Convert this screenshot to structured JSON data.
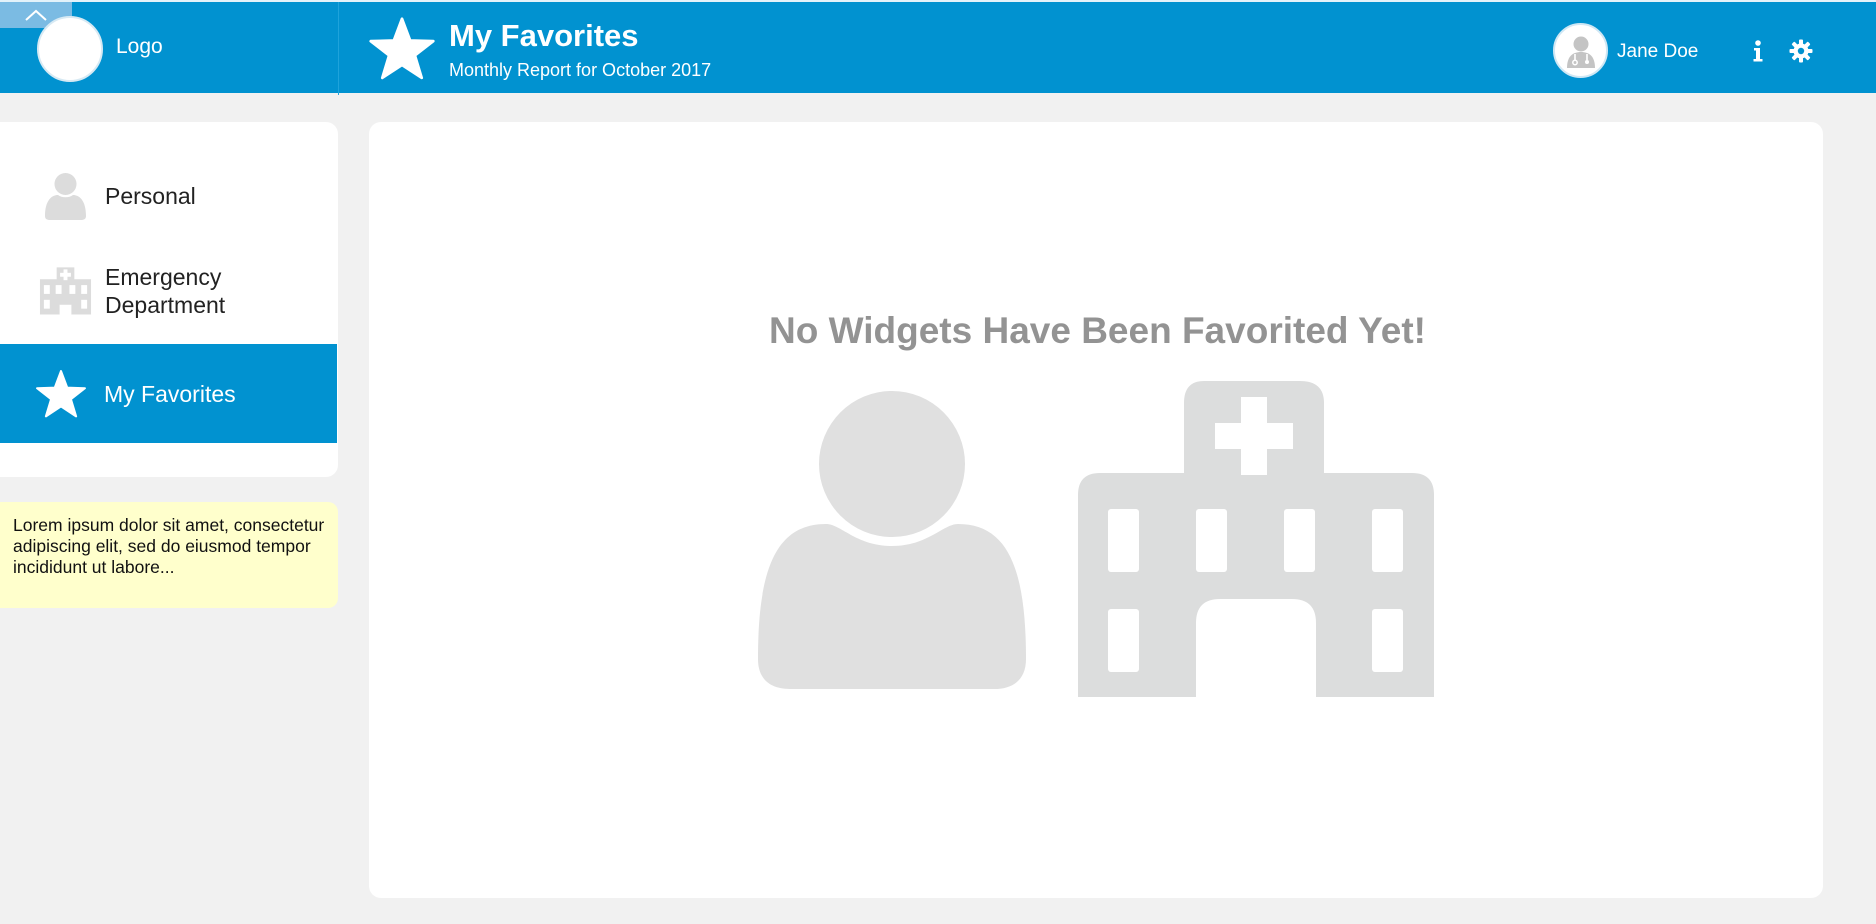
{
  "header": {
    "logo_label": "Logo",
    "title": "My Favorites",
    "subtitle": "Monthly Report for October 2017",
    "user_name": "Jane Doe",
    "icons": [
      "chevron-up-icon",
      "star-icon",
      "doctor-avatar-icon",
      "info-icon",
      "gear-icon"
    ]
  },
  "sidebar": {
    "items": [
      {
        "label": "Personal",
        "icon": "person-icon",
        "active": false
      },
      {
        "label": "Emergency Department",
        "line1": "Emergency",
        "line2": "Department",
        "icon": "hospital-icon",
        "active": false
      },
      {
        "label": "My Favorites",
        "icon": "star-icon",
        "active": true
      }
    ],
    "note": "Lorem ipsum dolor sit amet, consectetur adipiscing elit, sed do eiusmod tempor incididunt ut labore..."
  },
  "main": {
    "empty_message": "No Widgets Have Been Favorited Yet!",
    "illustrations": [
      "person-icon",
      "hospital-icon"
    ]
  },
  "colors": {
    "primary": "#0192d0",
    "background": "#f1f1f1",
    "note_background": "#ffffcc",
    "placeholder_icon": "#dcdcdc",
    "empty_text": "#939393"
  }
}
